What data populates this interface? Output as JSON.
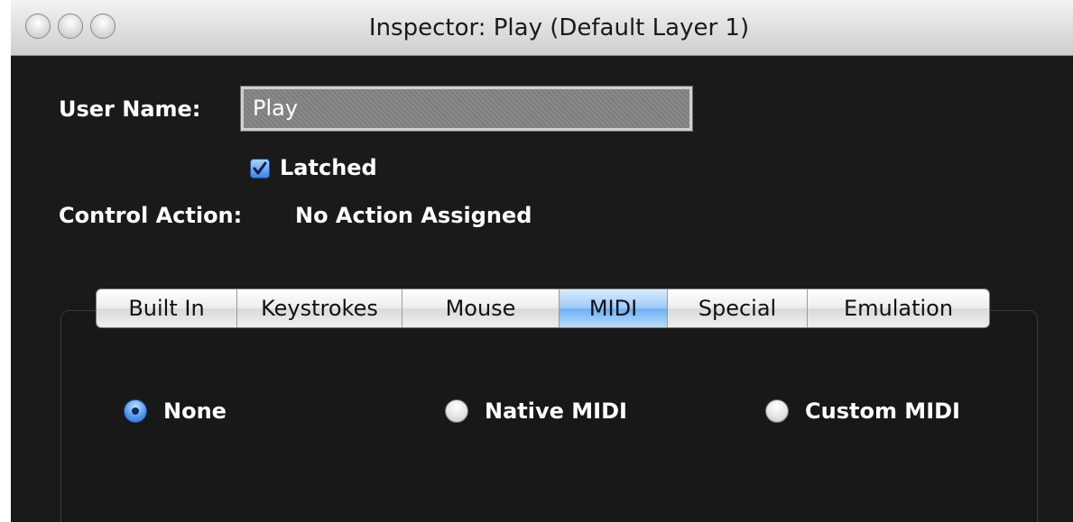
{
  "window": {
    "title": "Inspector: Play (Default Layer 1)"
  },
  "form": {
    "user_name_label": "User Name:",
    "user_name_value": "Play",
    "latched_label": "Latched",
    "latched_checked": true,
    "control_action_label": "Control Action:",
    "control_action_value": "No Action Assigned"
  },
  "tabs": [
    {
      "label": "Built In",
      "selected": false
    },
    {
      "label": "Keystrokes",
      "selected": false
    },
    {
      "label": "Mouse",
      "selected": false
    },
    {
      "label": "MIDI",
      "selected": true
    },
    {
      "label": "Special",
      "selected": false
    },
    {
      "label": "Emulation",
      "selected": false
    }
  ],
  "midi_options": [
    {
      "label": "None",
      "selected": true
    },
    {
      "label": "Native MIDI",
      "selected": false
    },
    {
      "label": "Custom MIDI",
      "selected": false
    }
  ],
  "icons": {
    "close": "close-icon",
    "minimize": "minimize-icon",
    "zoom": "zoom-icon",
    "check": "checkmark-icon"
  },
  "colors": {
    "background": "#1a1a1a",
    "text": "#ffffff",
    "selected_tab": "#8fc2f6",
    "accent": "#3d83e8"
  }
}
